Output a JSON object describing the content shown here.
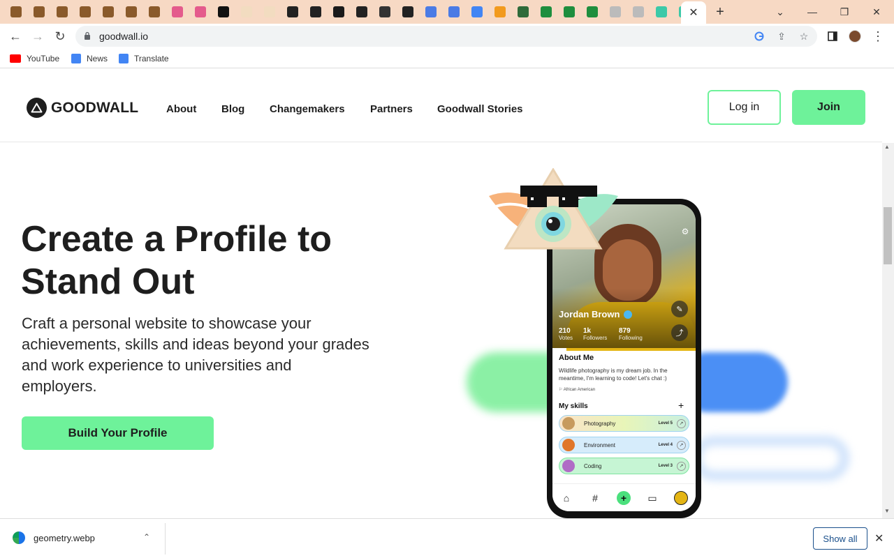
{
  "browser": {
    "tabs_favicon_colors": [
      "#8a5a2b",
      "#8a5a2b",
      "#8a5a2b",
      "#8a5a2b",
      "#8a5a2b",
      "#8a5a2b",
      "#8a5a2b",
      "#e45b8c",
      "#e45b8c",
      "#111111",
      "#f2dcc0",
      "#f2dcc0",
      "#222222",
      "#222222",
      "#1a1a1a",
      "#222222",
      "#333333",
      "#222222",
      "#4b7be5",
      "#4b7be5",
      "#4285f4",
      "#f29a1d",
      "#2f6b3a",
      "#1e8e3e",
      "#1e8e3e",
      "#1e8e3e",
      "#bbbbbb",
      "#bbbbbb",
      "#3cc9a8",
      "#3cc9a8"
    ],
    "active_tab_close": "✕",
    "new_tab": "+",
    "window": {
      "minimize": "—",
      "maximize": "❐",
      "close": "✕",
      "tabsearch": "⌄"
    },
    "url": "goodwall.io",
    "bookmarks": [
      {
        "label": "YouTube",
        "color": "#ff0000"
      },
      {
        "label": "News",
        "color": "#4285f4"
      },
      {
        "label": "Translate",
        "color": "#4285f4"
      }
    ]
  },
  "site": {
    "logo_text": "GOODWALL",
    "nav": [
      "About",
      "Blog",
      "Changemakers",
      "Partners",
      "Goodwall Stories"
    ],
    "login_label": "Log in",
    "join_label": "Join",
    "hero_title": "Create a Profile to Stand Out",
    "hero_subtitle": "Craft a personal website to showcase your achievements, skills and ideas beyond your grades and work experience to universities and employers.",
    "cta_label": "Build Your Profile",
    "accent_color": "#6ef29a"
  },
  "phone": {
    "name": "Jordan Brown",
    "stats": [
      {
        "value": "210",
        "label": "Votes"
      },
      {
        "value": "1k",
        "label": "Followers"
      },
      {
        "value": "879",
        "label": "Following"
      }
    ],
    "about_heading": "About Me",
    "about_text": "Wildlife photography is my dream job. In the meantime, I'm learning to code! Let's chat :)",
    "about_tag": "African American",
    "skills_heading": "My skills",
    "skills": [
      {
        "name": "Photography",
        "level": "Level 5",
        "bg": "linear-gradient(90deg,#fbe3c8,#e8f5b8,#c9f0e0)",
        "avatar": "#c79a5e"
      },
      {
        "name": "Environment",
        "level": "Level 4",
        "bg": "#d6ecfb",
        "avatar": "#e0762a"
      },
      {
        "name": "Coding",
        "level": "Level 3",
        "bg": "#c6f5d4",
        "avatar": "#b06cc6"
      }
    ]
  },
  "downloads": {
    "file_name": "geometry.webp",
    "show_all_label": "Show all"
  }
}
